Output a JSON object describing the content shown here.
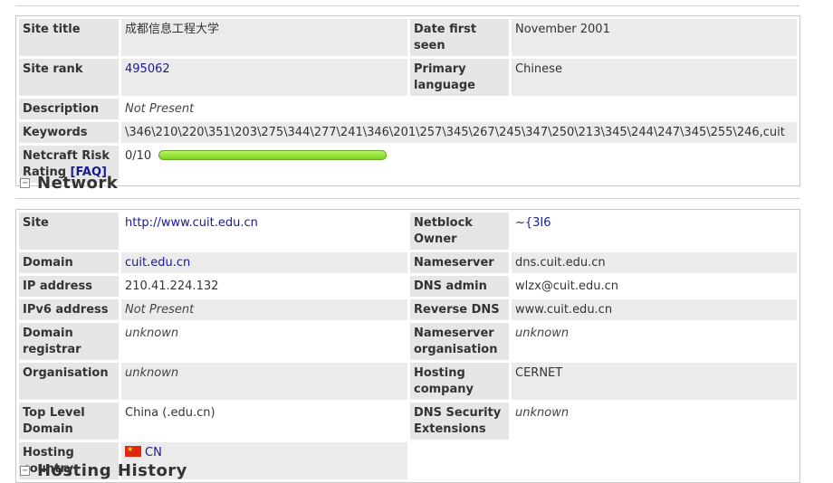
{
  "site_info": {
    "rows": [
      {
        "label": "Site title",
        "value": "成都信息工程大学",
        "label2": "Date first seen",
        "value2": "November 2001"
      },
      {
        "label": "Site rank",
        "value": "495062",
        "label2": "Primary language",
        "value2": "Chinese"
      },
      {
        "label": "Description",
        "value": "Not Present"
      },
      {
        "label": "Keywords",
        "value": "\\346\\210\\220\\351\\203\\275\\344\\277\\241\\346\\201\\257\\345\\267\\245\\347\\250\\213\\345\\244\\247\\345\\255\\246,cuit"
      },
      {
        "label": "Netcraft Risk Rating",
        "faq": "[FAQ]",
        "value": "0/10",
        "risk_score": 0
      }
    ]
  },
  "network": {
    "title": "Network",
    "rows": [
      {
        "label": "Site",
        "value": "http://www.cuit.edu.cn",
        "label2": "Netblock Owner",
        "value2": "~{3I6"
      },
      {
        "label": "Domain",
        "value": "cuit.edu.cn",
        "label2": "Nameserver",
        "value2": "dns.cuit.edu.cn"
      },
      {
        "label": "IP address",
        "value": "210.41.224.132",
        "label2": "DNS admin",
        "value2": "wlzx@cuit.edu.cn"
      },
      {
        "label": "IPv6 address",
        "value": "Not Present",
        "label2": "Reverse DNS",
        "value2": "www.cuit.edu.cn"
      },
      {
        "label": "Domain registrar",
        "value": "unknown",
        "label2": "Nameserver organisation",
        "value2": "unknown"
      },
      {
        "label": "Organisation",
        "value": "unknown",
        "label2": "Hosting company",
        "value2": "CERNET"
      },
      {
        "label": "Top Level Domain",
        "value": "China (.edu.cn)",
        "label2": "DNS Security Extensions",
        "value2": "unknown"
      },
      {
        "label": "Hosting country",
        "value": "CN",
        "flag_icon": "china-flag-icon"
      }
    ]
  },
  "hosting_history": {
    "title": "Hosting History"
  },
  "colors": {
    "label_bg": "#e6e6e6",
    "link": "#1a1a8c",
    "risk_bar": "#8fe33a"
  }
}
